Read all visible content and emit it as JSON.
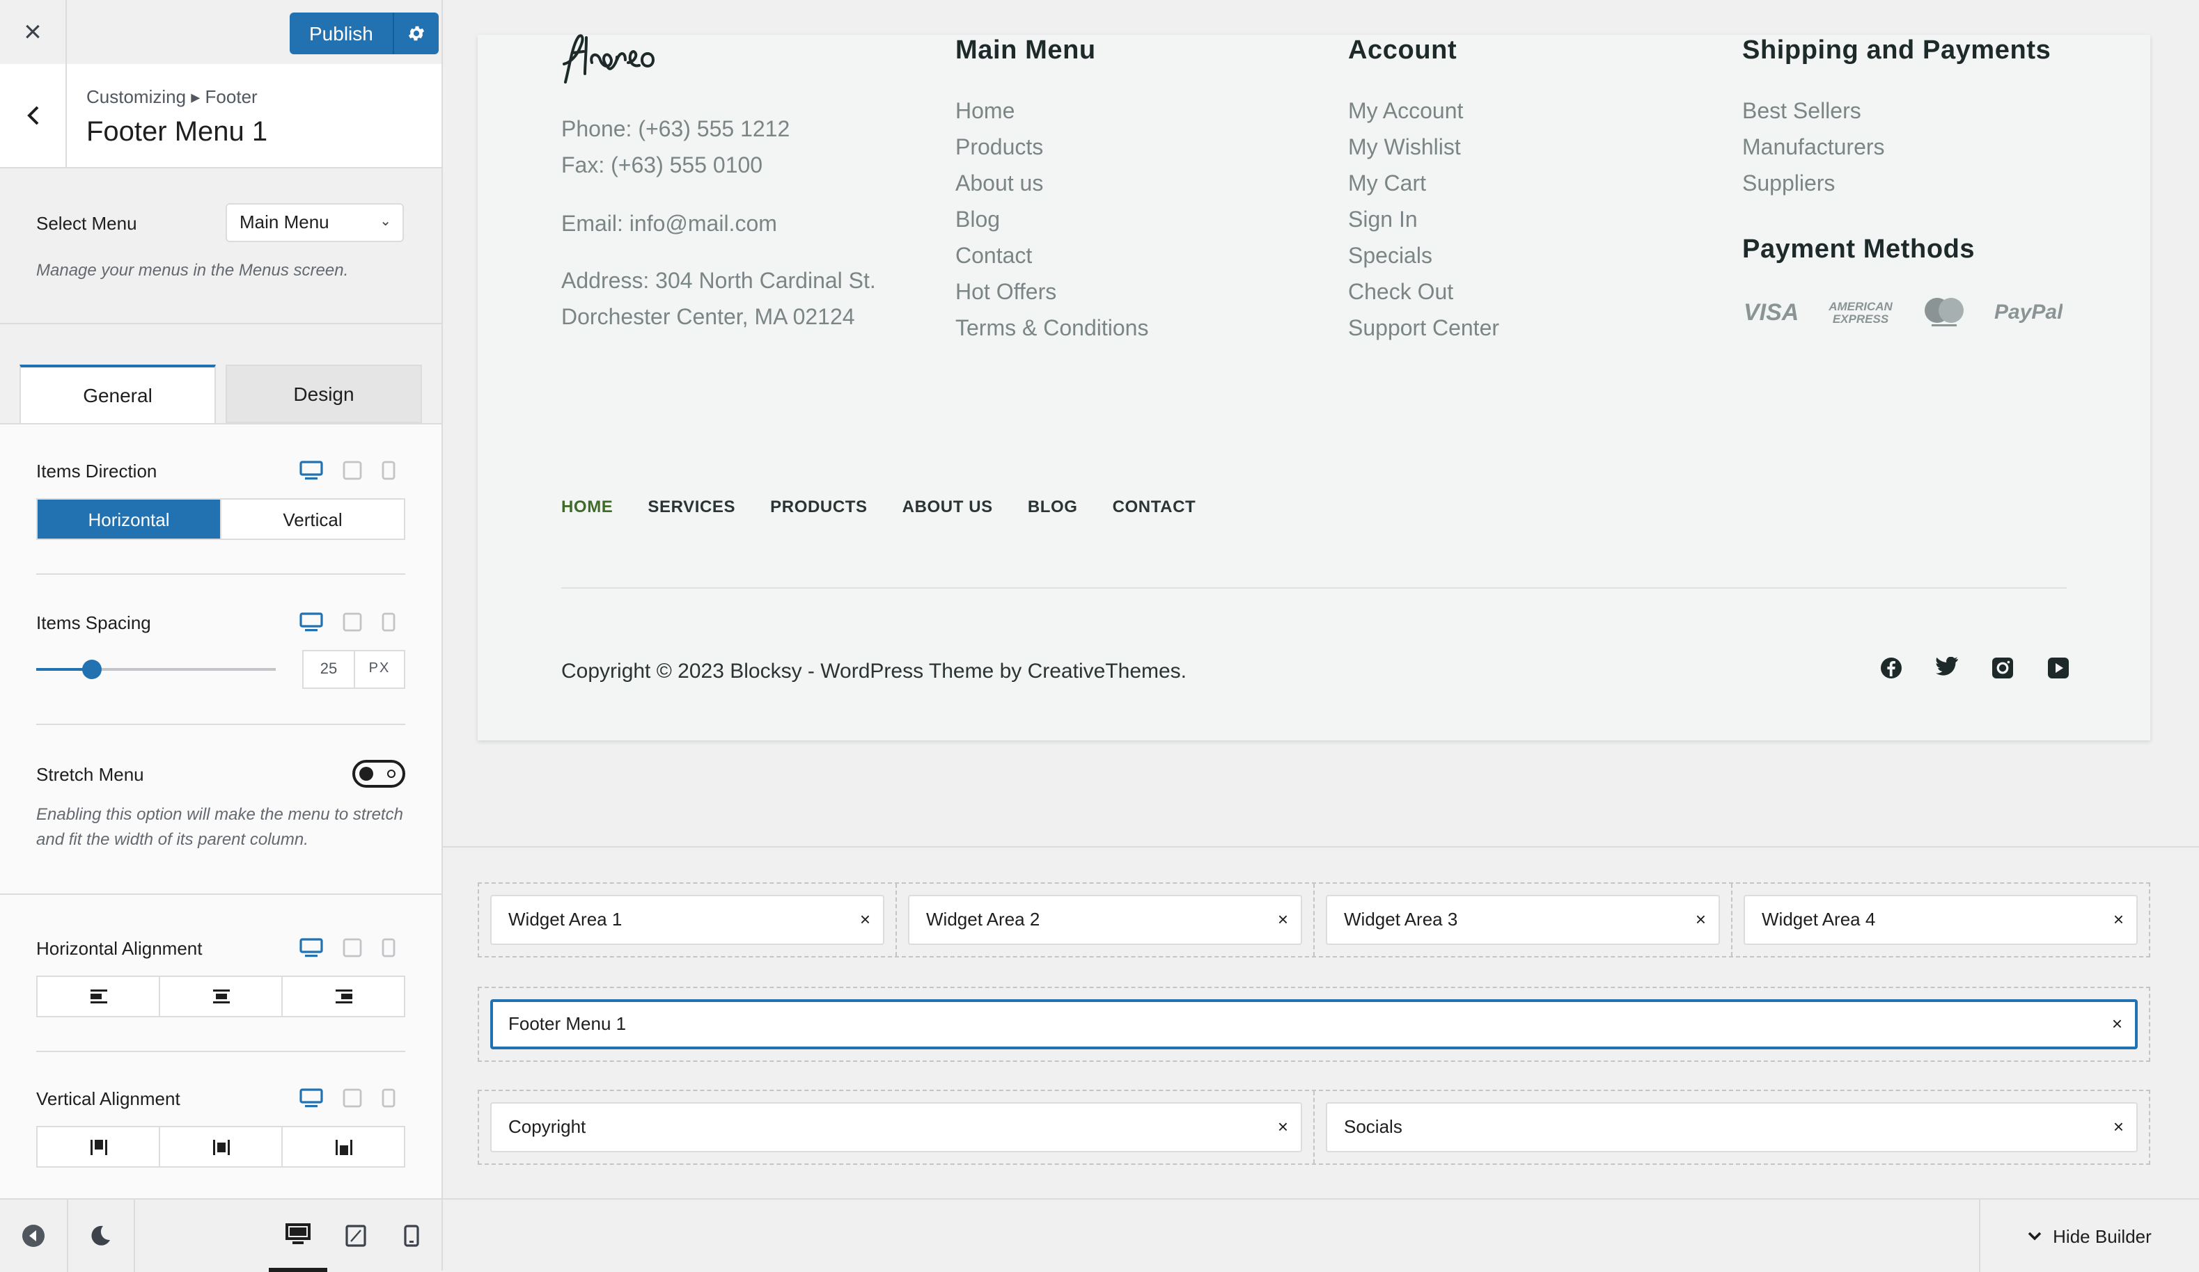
{
  "sidebar": {
    "close_icon": "×",
    "publish_label": "Publish",
    "breadcrumb": "Customizing ▸ Footer",
    "section_title": "Footer Menu 1",
    "select_menu": {
      "label": "Select Menu",
      "value": "Main Menu",
      "description": "Manage your menus in the Menus screen."
    },
    "tabs": [
      {
        "label": "General",
        "active": true
      },
      {
        "label": "Design",
        "active": false
      }
    ],
    "items_direction": {
      "label": "Items Direction",
      "options": [
        "Horizontal",
        "Vertical"
      ],
      "selected": "Horizontal"
    },
    "items_spacing": {
      "label": "Items Spacing",
      "value": "25",
      "unit": "PX",
      "slider_percent": 23
    },
    "stretch_menu": {
      "label": "Stretch Menu",
      "enabled": false,
      "description": "Enabling this option will make the menu to stretch and fit the width of its parent column."
    },
    "horizontal_alignment": {
      "label": "Horizontal Alignment",
      "options": [
        "align-left",
        "align-center",
        "align-right"
      ]
    },
    "vertical_alignment": {
      "label": "Vertical Alignment",
      "options": [
        "align-top",
        "align-middle",
        "align-bottom"
      ]
    },
    "accent_color": "#2271b1"
  },
  "preview": {
    "logo": "floreo",
    "contact": {
      "phone": "Phone: (+63) 555 1212",
      "fax": "Fax: (+63) 555 0100",
      "email": "Email: info@mail.com",
      "address_line1": "Address: 304 North Cardinal St.",
      "address_line2": "Dorchester Center, MA 02124"
    },
    "main_menu": {
      "title": "Main Menu",
      "items": [
        "Home",
        "Products",
        "About us",
        "Blog",
        "Contact",
        "Hot Offers",
        "Terms & Conditions"
      ]
    },
    "account": {
      "title": "Account",
      "items": [
        "My Account",
        "My Wishlist",
        "My Cart",
        "Sign In",
        "Specials",
        "Check Out",
        "Support Center"
      ]
    },
    "shipping": {
      "title": "Shipping and Payments",
      "items": [
        "Best Sellers",
        "Manufacturers",
        "Suppliers"
      ]
    },
    "payment_methods": {
      "title": "Payment Methods",
      "icons": [
        "visa-icon",
        "amex-icon",
        "mastercard-icon",
        "paypal-icon"
      ],
      "labels": {
        "visa": "VISA",
        "amex_line1": "AMERICAN",
        "amex_line2": "EXPRESS",
        "paypal": "PayPal"
      }
    },
    "footer_nav": [
      "HOME",
      "SERVICES",
      "PRODUCTS",
      "ABOUT US",
      "BLOG",
      "CONTACT"
    ],
    "footer_nav_active": "HOME",
    "copyright": "Copyright © 2023 Blocksy - WordPress Theme by CreativeThemes.",
    "socials": [
      "facebook-icon",
      "twitter-icon",
      "instagram-icon",
      "youtube-icon"
    ]
  },
  "builder": {
    "row1": [
      "Widget Area 1",
      "Widget Area 2",
      "Widget Area 3",
      "Widget Area 4"
    ],
    "row2": [
      "Footer Menu 1"
    ],
    "row3": [
      "Copyright",
      "Socials"
    ],
    "remove_icon": "×",
    "hide_builder_label": "Hide Builder"
  }
}
